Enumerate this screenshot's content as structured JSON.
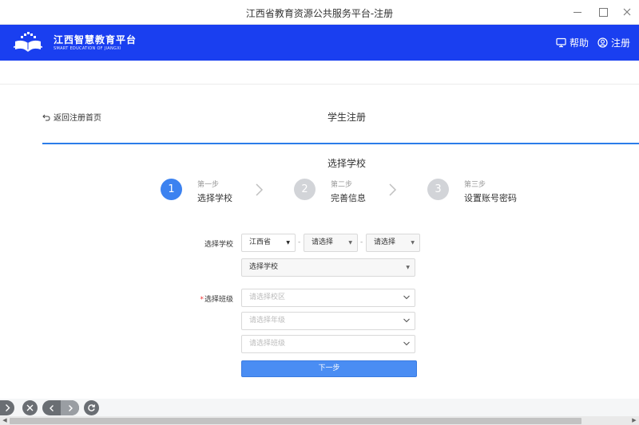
{
  "window": {
    "title": "江西省教育资源公共服务平台-注册"
  },
  "header": {
    "logo_title": "江西智慧教育平台",
    "logo_subtitle": "SMART EDUCATION OF JIANGXI",
    "help_label": "帮助",
    "register_label": "注册",
    "background_color": "#1a3ff0"
  },
  "page": {
    "back_label": "返回注册首页",
    "title": "学生注册",
    "section_title": "选择学校",
    "accent_color": "#2b7de9"
  },
  "steps": [
    {
      "number": "1",
      "sub": "第一步",
      "name": "选择学校",
      "state": "active"
    },
    {
      "number": "2",
      "sub": "第二步",
      "name": "完善信息",
      "state": "inactive"
    },
    {
      "number": "3",
      "sub": "第三步",
      "name": "设置账号密码",
      "state": "inactive"
    }
  ],
  "form": {
    "school_label": "选择学校",
    "province_value": "江西省",
    "city_value": "请选择",
    "district_value": "请选择",
    "separator": "-",
    "school_select_value": "选择学校",
    "class_label_required": "*",
    "class_label": "选择班级",
    "campus_placeholder": "请选择校区",
    "grade_placeholder": "请选择年级",
    "class_placeholder": "请选择班级",
    "next_button": "下一步"
  },
  "icons": {
    "help": "monitor-icon",
    "register": "user-circle-icon",
    "back": "undo-arrow-icon",
    "step_separator": "chevron-right-icon",
    "dropdown": "chevron-down-icon"
  }
}
